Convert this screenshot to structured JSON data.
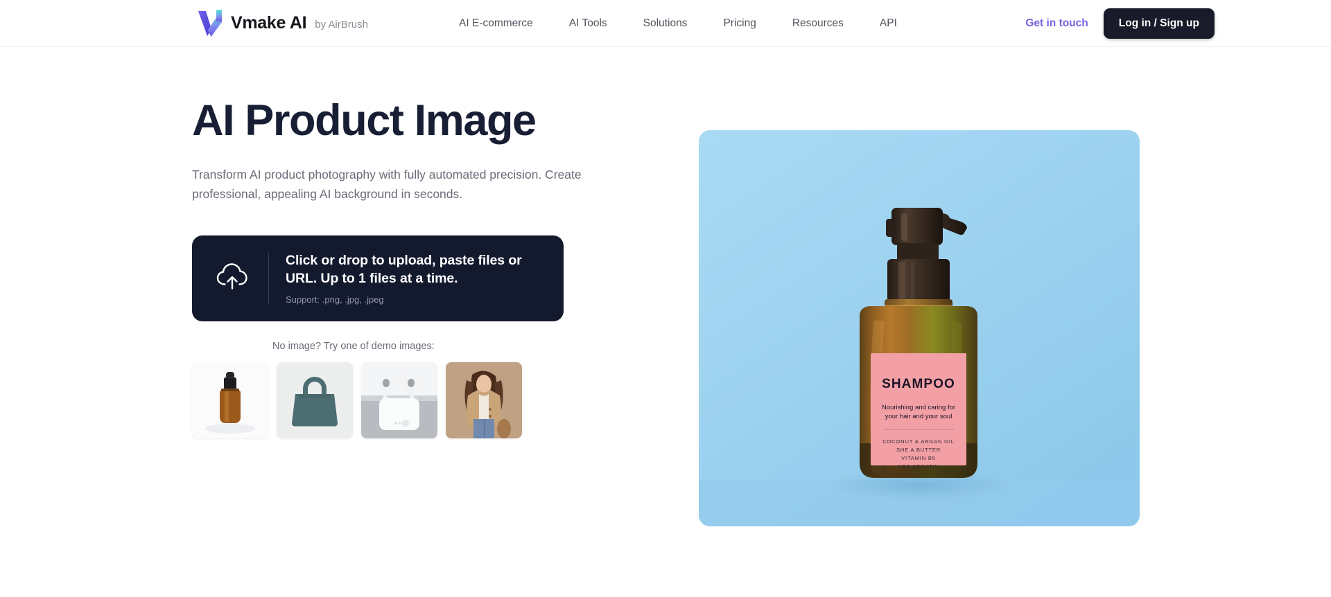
{
  "header": {
    "brand": {
      "name": "Vmake AI",
      "by": "by AirBrush",
      "logo_icon": "vmake-v-logo"
    },
    "nav": [
      {
        "label": "AI E-commerce"
      },
      {
        "label": "AI Tools"
      },
      {
        "label": "Solutions"
      },
      {
        "label": "Pricing"
      },
      {
        "label": "Resources"
      },
      {
        "label": "API"
      }
    ],
    "get_in_touch": "Get in touch",
    "login_signup": "Log in / Sign up",
    "colors": {
      "accent_purple": "#7263e0",
      "button_dark": "#191b2b"
    }
  },
  "hero": {
    "title": "AI Product Image",
    "subtitle": "Transform AI product photography with fully automated precision. Create professional, appealing AI background in seconds."
  },
  "upload": {
    "icon": "cloud-upload-icon",
    "main_text": "Click or drop to upload, paste files or URL. Up to 1 files at a time.",
    "support_text": "Support: .png, .jpg, .jpeg",
    "background": "#141a2e"
  },
  "demos": {
    "label": "No image? Try one of demo images:",
    "items": [
      {
        "name": "dropper-bottle",
        "alt": "Amber serum dropper bottle on white background"
      },
      {
        "name": "handbag",
        "alt": "Teal leather tote handbag on light grey background"
      },
      {
        "name": "earbuds",
        "alt": "White wireless earbuds in charging case"
      },
      {
        "name": "model-coat",
        "alt": "Model wearing beige trench coat on tan background"
      }
    ]
  },
  "product_image": {
    "alt": "Amber glass shampoo pump bottle on light blue background",
    "background_color": "#9ed3f0",
    "label": {
      "title": "SHAMPOO",
      "tagline_line1": "Nourishing and caring for",
      "tagline_line2": "your hair and your soul",
      "ingredients": [
        "COCONUT & ARGAN OIL",
        "SHE A BUTTER",
        "VITAMIN B5",
        "VEG KERATIN"
      ],
      "label_color": "#f2a0a6"
    }
  }
}
